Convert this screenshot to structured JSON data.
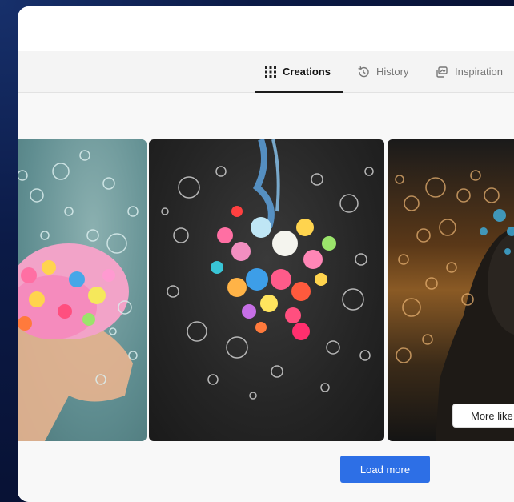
{
  "tabs": [
    {
      "label": "Creations",
      "icon": "grid-icon",
      "active": true
    },
    {
      "label": "History",
      "icon": "history-icon",
      "active": false
    },
    {
      "label": "Inspiration",
      "icon": "inspiration-icon",
      "active": false
    }
  ],
  "gallery": {
    "more_like_label": "More like",
    "load_more_label": "Load more"
  },
  "colors": {
    "accent": "#2d6fe6",
    "background": "#0b1a46"
  }
}
